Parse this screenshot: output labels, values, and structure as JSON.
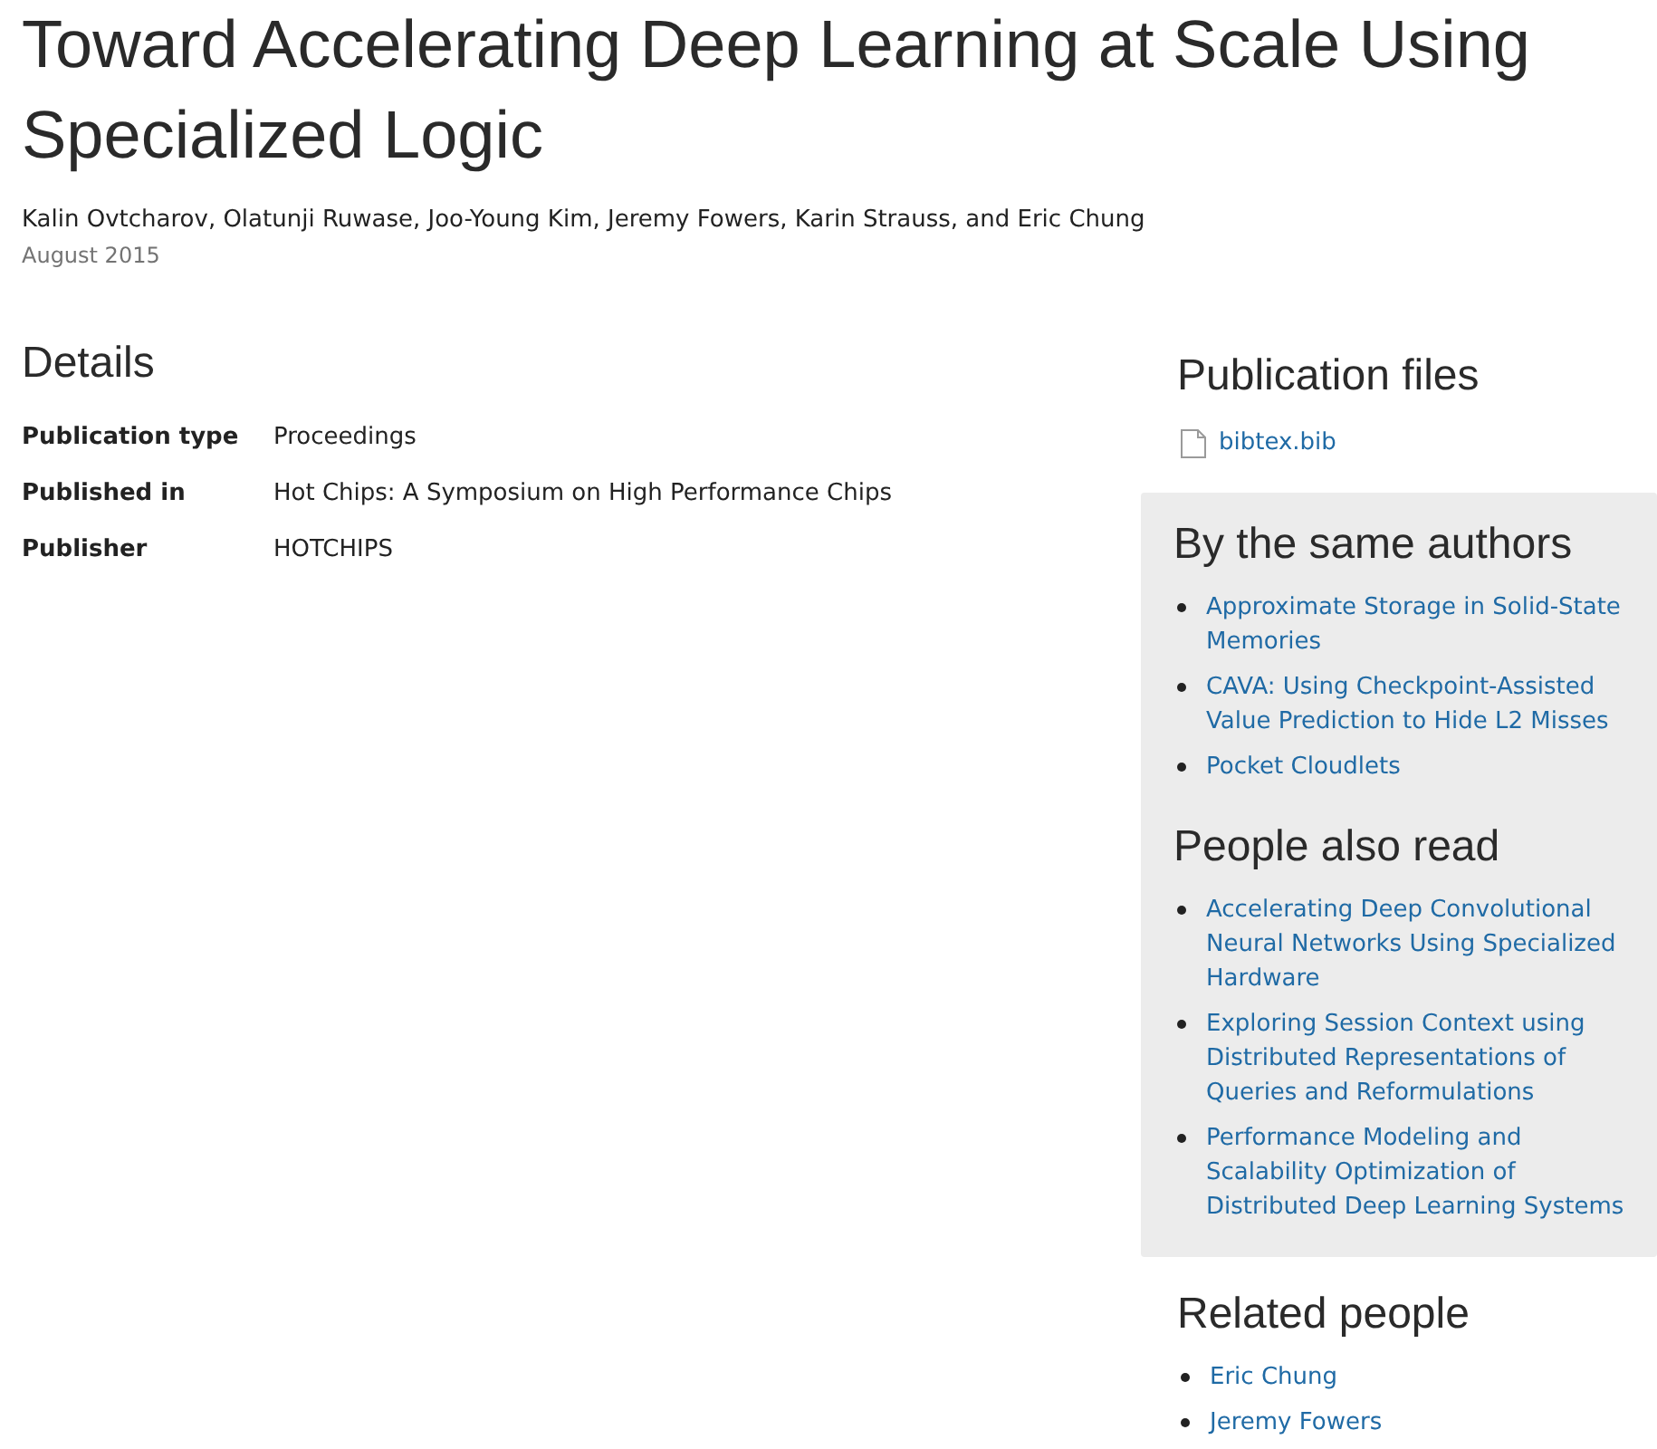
{
  "title": "Toward Accelerating Deep Learning at Scale Using Specialized Logic",
  "authors": "Kalin Ovtcharov, Olatunji Ruwase, Joo-Young Kim, Jeremy Fowers, Karin Strauss, and Eric Chung",
  "date": "August 2015",
  "details": {
    "heading": "Details",
    "rows": [
      {
        "label": "Publication type",
        "value": "Proceedings"
      },
      {
        "label": "Published in",
        "value": "Hot Chips: A Symposium on High Performance Chips"
      },
      {
        "label": "Publisher",
        "value": "HOTCHIPS"
      }
    ]
  },
  "publication_files": {
    "heading": "Publication files",
    "files": [
      "bibtex.bib"
    ]
  },
  "same_authors": {
    "heading": "By the same authors",
    "items": [
      "Approximate Storage in Solid-State Memories",
      "CAVA: Using Checkpoint-Assisted Value Prediction to Hide L2 Misses",
      "Pocket Cloudlets"
    ]
  },
  "people_also_read": {
    "heading": "People also read",
    "items": [
      "Accelerating Deep Convolutional Neural Networks Using Specialized Hardware",
      "Exploring Session Context using Distributed Representations of Queries and Reformulations",
      "Performance Modeling and Scalability Optimization of Distributed Deep Learning Systems"
    ]
  },
  "related_people": {
    "heading": "Related people",
    "items": [
      "Eric Chung",
      "Jeremy Fowers"
    ]
  }
}
